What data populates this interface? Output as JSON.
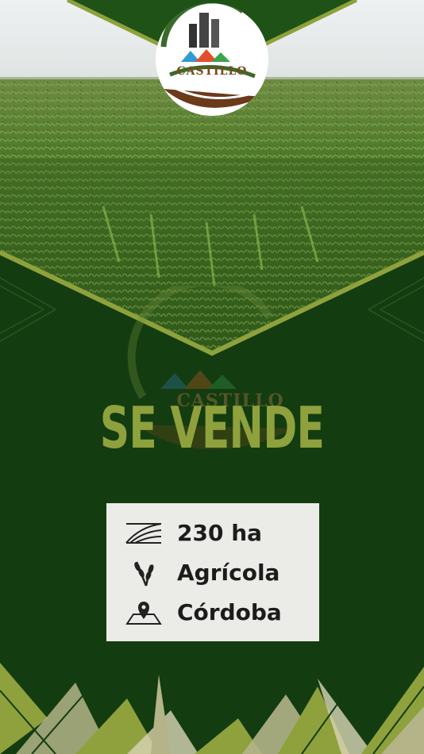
{
  "brand": {
    "name": "CASTILLO",
    "watermark_name": "CASTILLO"
  },
  "headline": "SE VENDE",
  "details": [
    {
      "icon": "land-area-icon",
      "text": "230 ha"
    },
    {
      "icon": "wheat-icon",
      "text": "Agrícola"
    },
    {
      "icon": "map-pin-icon",
      "text": "Córdoba"
    }
  ],
  "colors": {
    "background": "#133c10",
    "accent": "#8ea13c",
    "card": "#ebece8",
    "text": "#1c1c1c",
    "brown": "#6b3a1a"
  },
  "photo": {
    "subject": "field-photo"
  }
}
